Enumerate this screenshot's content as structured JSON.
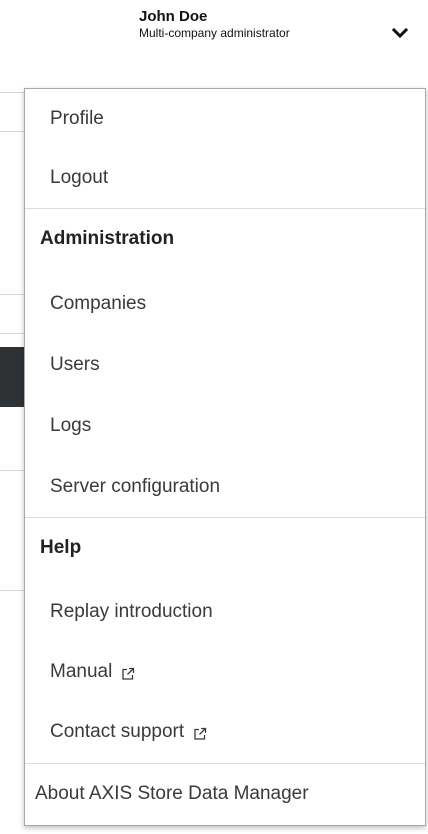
{
  "user": {
    "name": "John Doe",
    "role": "Multi-company administrator",
    "menu_toggle_icon": "chevron-down-icon"
  },
  "menu": {
    "account_items": [
      {
        "label": "Profile"
      },
      {
        "label": "Logout"
      }
    ],
    "administration": {
      "heading": "Administration",
      "items": [
        {
          "label": "Companies"
        },
        {
          "label": "Users"
        },
        {
          "label": "Logs"
        },
        {
          "label": "Server configuration"
        }
      ]
    },
    "help": {
      "heading": "Help",
      "items": [
        {
          "label": "Replay introduction"
        },
        {
          "label": "Manual",
          "icon": "external-link-icon"
        },
        {
          "label": "Contact support",
          "icon": "external-link-icon"
        }
      ]
    },
    "about": {
      "label": "About AXIS Store Data Manager"
    }
  },
  "colors": {
    "menu_text": "#3a3a3a",
    "heading_text": "#222222",
    "divider": "#dcdcdc",
    "menu_border": "#a8a8a8"
  }
}
